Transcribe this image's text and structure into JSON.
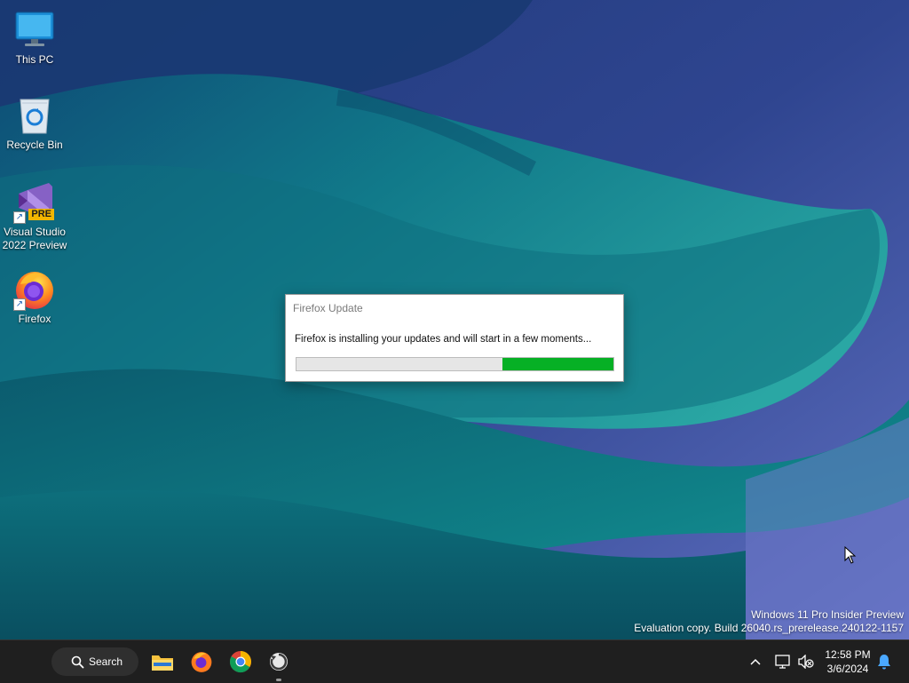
{
  "desktop": {
    "icons": [
      {
        "label": "This PC",
        "icon": "monitor-icon"
      },
      {
        "label": "Recycle Bin",
        "icon": "recycle-bin-icon"
      },
      {
        "label": "Visual Studio 2022 Preview",
        "icon": "visual-studio-icon",
        "badge": "PRE"
      },
      {
        "label": "Firefox",
        "icon": "firefox-icon"
      }
    ]
  },
  "dialog": {
    "title": "Firefox Update",
    "message": "Firefox is installing your updates and will start in a few moments...",
    "progress_state": "indeterminate",
    "progress_color": "#06b025"
  },
  "watermark": {
    "line1": "Windows 11 Pro Insider Preview",
    "line2": "Evaluation copy. Build 26040.rs_prerelease.240122-1157"
  },
  "taskbar": {
    "search_label": "Search",
    "apps": [
      {
        "name": "File Explorer",
        "icon": "folder-icon"
      },
      {
        "name": "Firefox",
        "icon": "firefox-icon"
      },
      {
        "name": "Google Chrome",
        "icon": "chrome-icon"
      },
      {
        "name": "Firefox Updater",
        "icon": "updater-icon",
        "active": true
      }
    ],
    "clock": {
      "time": "12:58 PM",
      "date": "3/6/2024"
    },
    "tray": [
      "chevron-up-icon",
      "network-icon",
      "volume-muted-icon",
      "notification-bell-icon"
    ]
  },
  "colors": {
    "taskbar_bg": "#1f1f1f",
    "accent": "#0078d4"
  }
}
